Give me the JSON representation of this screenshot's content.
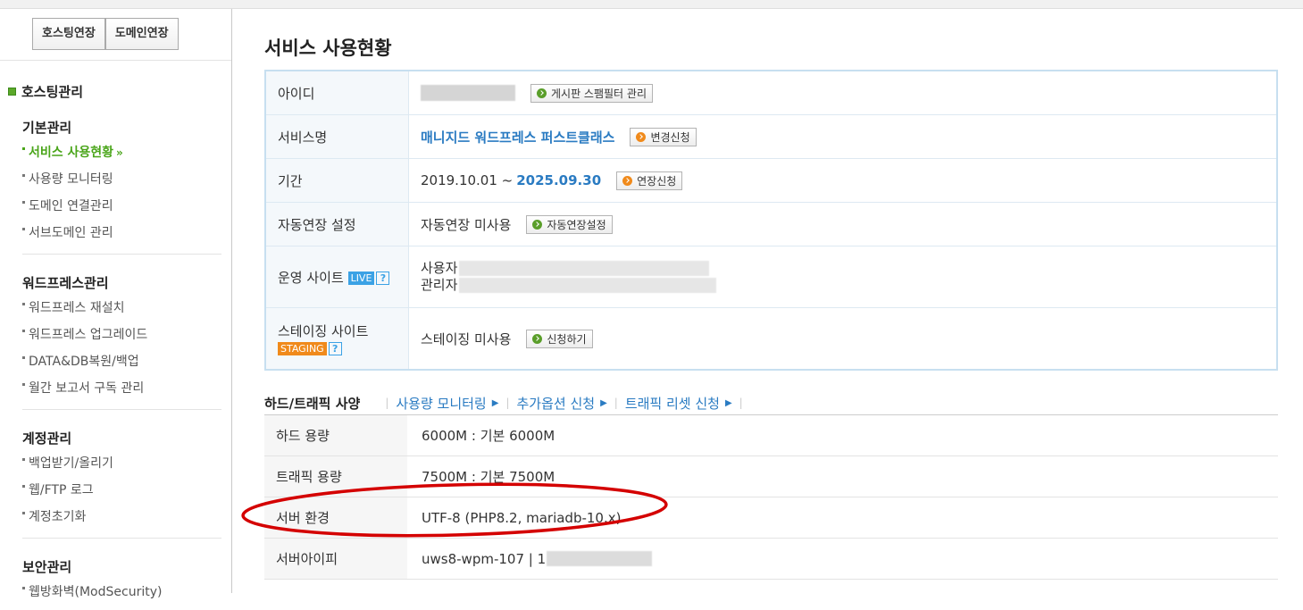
{
  "sidebar": {
    "ext_buttons": [
      "호스팅연장",
      "도메인연장"
    ],
    "section_title": "호스팅관리",
    "groups": [
      {
        "title": "기본관리",
        "items": [
          "서비스 사용현황",
          "사용량 모니터링",
          "도메인 연결관리",
          "서브도메인 관리"
        ]
      },
      {
        "title": "워드프레스관리",
        "items": [
          "워드프레스 재설치",
          "워드프레스 업그레이드",
          "DATA&DB복원/백업",
          "월간 보고서 구독 관리"
        ]
      },
      {
        "title": "계정관리",
        "items": [
          "백업받기/올리기",
          "웹/FTP 로그",
          "계정초기화"
        ]
      },
      {
        "title": "보안관리",
        "items": [
          "웹방화벽(ModSecurity)"
        ]
      }
    ],
    "active_item": "서비스 사용현황",
    "active_arrow": "»"
  },
  "main": {
    "title": "서비스 사용현황",
    "info": {
      "id_label": "아이디",
      "id_button": "게시판 스팸필터 관리",
      "service_label": "서비스명",
      "service_name": "매니지드 워드프레스 퍼스트클래스",
      "service_button": "변경신청",
      "period_label": "기간",
      "period_start": "2019.10.01 ~",
      "period_end": "2025.09.30",
      "period_button": "연장신청",
      "auto_label": "자동연장 설정",
      "auto_value": "자동연장 미사용",
      "auto_button": "자동연장설정",
      "live_label": "운영 사이트",
      "live_badge": "LIVE",
      "live_help": "?",
      "live_user_label": "사용자",
      "live_admin_label": "관리자",
      "staging_label": "스테이징 사이트",
      "staging_badge": "STAGING",
      "staging_help": "?",
      "staging_value": "스테이징 미사용",
      "staging_button": "신청하기"
    },
    "spec": {
      "title": "하드/트래픽 사양",
      "links": [
        "사용량 모니터링",
        "추가옵션 신청",
        "트래픽 리셋 신청"
      ],
      "rows": [
        {
          "label": "하드 용량",
          "value": "6000M : 기본 6000M"
        },
        {
          "label": "트래픽 용량",
          "value": "7500M : 기본 7500M"
        },
        {
          "label": "서버 환경",
          "value": "UTF-8 (PHP8.2, mariadb-10.x)"
        },
        {
          "label": "서버아이피",
          "value": "uws8-wpm-107 | 1"
        }
      ]
    }
  },
  "colors": {
    "accent_green": "#4aa51a",
    "link_blue": "#2a7bc2",
    "annotation_red": "#d40000",
    "orange": "#f08a1b"
  }
}
